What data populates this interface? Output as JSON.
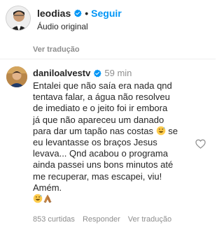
{
  "post": {
    "username": "leodias",
    "separator": "•",
    "follow_label": "Seguir",
    "audio_label": "Áudio original",
    "translate_label": "Ver tradução"
  },
  "comment": {
    "username": "daniloalvestv",
    "time": "59 min",
    "lines": [
      "Entalei que não saía era nada qnd",
      "tentava falar, a água não resolveu",
      "de imediato e o jeito foi ir embora",
      "já que não apareceu um danado",
      "para dar um tapão nas costas",
      "se",
      "eu levantasse os braços Jesus",
      "levava... Qnd acabou o programa",
      "ainda passei uns bons minutos até",
      "me recuperar, mas escapei, viu!",
      "Amém."
    ],
    "likes": "853 curtidas",
    "reply_label": "Responder",
    "translate_label": "Ver tradução"
  },
  "icons": {
    "verified": "verified-badge-icon",
    "heart": "heart-outline-icon",
    "emoji_sweat_smile": "sweat-smile-emoji-icon",
    "emoji_pray": "folded-hands-emoji-icon"
  },
  "colors": {
    "accent": "#0095f6",
    "muted": "#8e8e8e",
    "text": "#262626"
  }
}
